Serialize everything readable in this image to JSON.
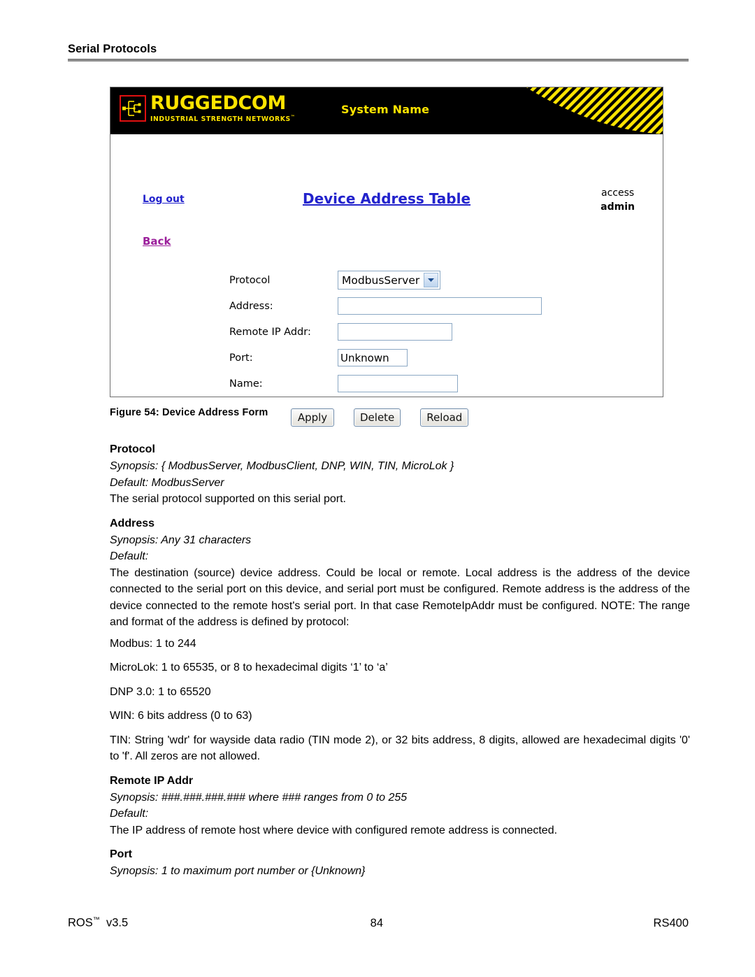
{
  "page": {
    "running_head": "Serial Protocols",
    "figure_caption": "Figure 54: Device Address Form"
  },
  "screenshot": {
    "banner": {
      "logo_name": "RUGGEDCOM",
      "logo_tagline": "INDUSTRIAL STRENGTH NETWORKS",
      "logo_tagline_mark": "™",
      "system_name": "System Name",
      "background_color": "#000000",
      "accent_color": "#ffe400",
      "logo_border_color": "#e01010"
    },
    "toolbar": {
      "logout_label": "Log out",
      "page_title": "Device Address Table",
      "access_label": "access",
      "access_role": "admin",
      "back_label": "Back",
      "link_color": "#2222cc",
      "back_link_color": "#9b1f9b"
    },
    "form": {
      "rows": [
        {
          "label": "Protocol",
          "control": "select",
          "value": "ModbusServer"
        },
        {
          "label": "Address:",
          "control": "text",
          "value": "",
          "placeholder": ""
        },
        {
          "label": "Remote IP Addr:",
          "control": "text",
          "value": "",
          "placeholder": ""
        },
        {
          "label": "Port:",
          "control": "text",
          "value": "Unknown",
          "placeholder": ""
        },
        {
          "label": "Name:",
          "control": "text",
          "value": "",
          "placeholder": ""
        }
      ],
      "protocol_options": [
        "ModbusServer",
        "ModbusClient",
        "DNP",
        "WIN",
        "TIN",
        "MicroLok"
      ]
    },
    "buttons": [
      {
        "label": "Apply"
      },
      {
        "label": "Delete"
      },
      {
        "label": "Reload"
      }
    ]
  },
  "content": {
    "protocol": {
      "heading": "Protocol",
      "synopsis": "Synopsis: { ModbusServer, ModbusClient, DNP, WIN, TIN, MicroLok }",
      "default": "Default: ModbusServer",
      "description": "The serial protocol supported on this serial port."
    },
    "address": {
      "heading": "Address",
      "synopsis": "Synopsis: Any 31 characters",
      "default": "Default:",
      "description": "The destination (source) device address. Could be local or remote. Local address is the address of the device connected to the serial port on this device, and serial port must be configured. Remote address is the address of the device connected to the remote host's serial port. In that case RemoteIpAddr must be configured. NOTE: The range and format of the address is defined by protocol:",
      "ranges": [
        "Modbus: 1 to 244",
        "MicroLok: 1 to 65535, or 8 to  hexadecimal digits  ‘1’ to ‘a’",
        "DNP 3.0: 1 to 65520",
        "WIN: 6 bits address (0 to 63)"
      ],
      "tin_note": "TIN: String 'wdr' for wayside data radio (TIN mode 2), or 32 bits address, 8 digits, allowed are hexadecimal digits '0' to 'f'. All zeros are not allowed."
    },
    "remote_ip_addr": {
      "heading": "Remote IP Addr",
      "synopsis": "Synopsis: ###.###.###.###  where ### ranges from 0 to 255",
      "default": "Default:",
      "description": "The IP address of remote host where device with configured remote address is connected."
    },
    "port": {
      "heading": "Port",
      "synopsis": "Synopsis: 1 to maximum port number or {Unknown}"
    }
  },
  "footer": {
    "product": "ROS",
    "product_mark": "™",
    "version": "v3.5",
    "page_number": "84",
    "model": "RS400"
  }
}
